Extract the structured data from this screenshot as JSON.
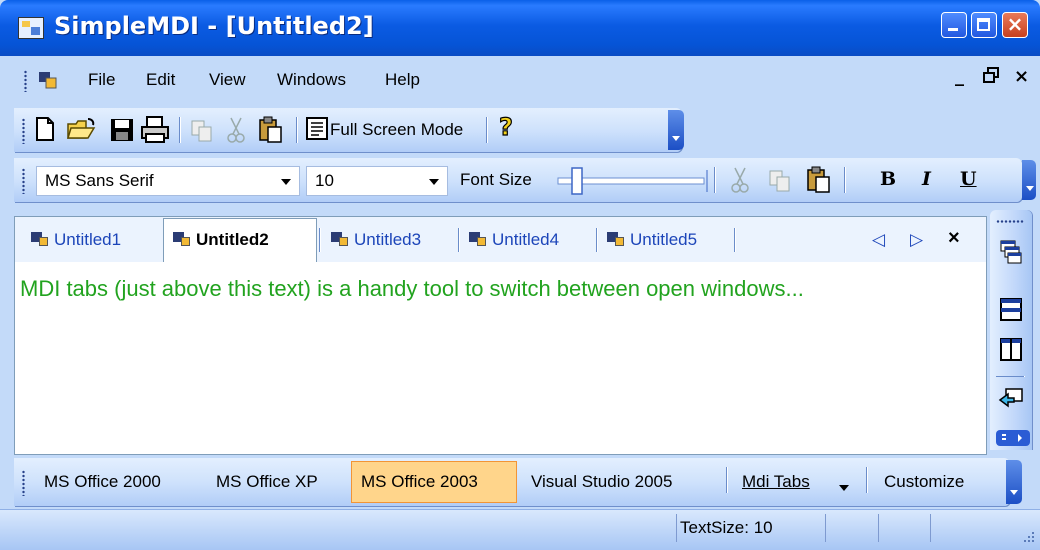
{
  "window": {
    "title": "SimpleMDI - [Untitled2]"
  },
  "menu": {
    "items": [
      {
        "label": "File"
      },
      {
        "label": "Edit"
      },
      {
        "label": "View"
      },
      {
        "label": "Windows"
      },
      {
        "label": "Help"
      }
    ],
    "mdi_controls": [
      "_",
      "🗗",
      "×"
    ]
  },
  "standard_toolbar": {
    "full_screen_label": "Full Screen Mode"
  },
  "format_toolbar": {
    "font_name": "MS Sans Serif",
    "font_size": "10",
    "font_size_label": "Font Size",
    "bold": "B",
    "italic": "I",
    "underline": "U"
  },
  "tabs": [
    {
      "label": "Untitled1",
      "active": false
    },
    {
      "label": "Untitled2",
      "active": true
    },
    {
      "label": "Untitled3",
      "active": false
    },
    {
      "label": "Untitled4",
      "active": false
    },
    {
      "label": "Untitled5",
      "active": false
    }
  ],
  "tab_controls": {
    "prev": "◁",
    "next": "▷",
    "close": "×"
  },
  "document": {
    "text": "MDI tabs (just above this text) is a handy tool to switch between open windows..."
  },
  "style_toolbar": {
    "items": [
      "MS Office 2000",
      "MS Office XP",
      "MS Office 2003",
      "Visual Studio 2005",
      "Mdi Tabs",
      "Customize"
    ],
    "selected": "MS Office 2003"
  },
  "statusbar": {
    "text_size": "TextSize: 10"
  },
  "colors": {
    "accent": "#0a5fe8",
    "highlight": "#ffd58b",
    "doc_text": "#22a31f"
  }
}
